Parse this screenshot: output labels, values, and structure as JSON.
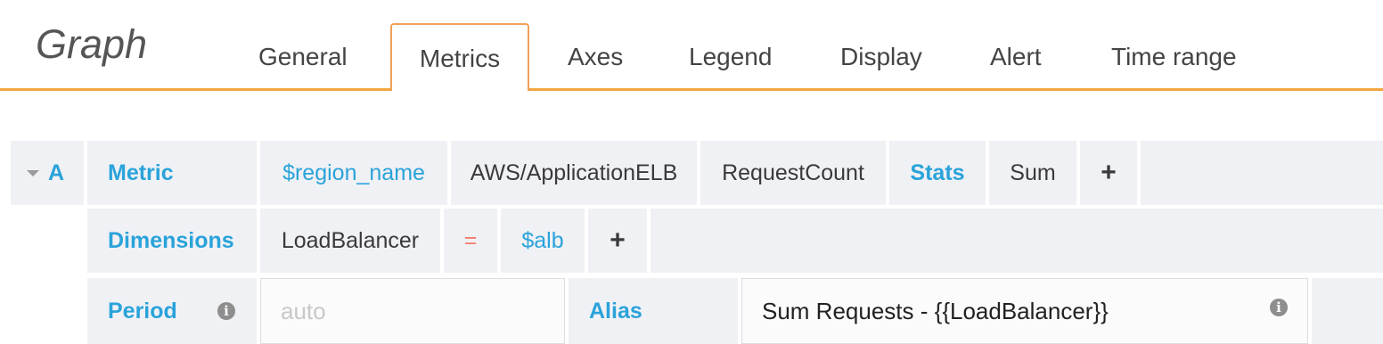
{
  "header": {
    "title": "Graph",
    "tabs": [
      "General",
      "Metrics",
      "Axes",
      "Legend",
      "Display",
      "Alert",
      "Time range"
    ],
    "active_tab": "Metrics",
    "accent_color": "#f2a63d"
  },
  "query": {
    "ref_id": "A",
    "metric_label": "Metric",
    "region": "$region_name",
    "namespace": "AWS/ApplicationELB",
    "metric_name": "RequestCount",
    "stats_label": "Stats",
    "stat": "Sum",
    "add_stat": "+",
    "dimensions_label": "Dimensions",
    "dimension_key": "LoadBalancer",
    "dimension_operator": "=",
    "dimension_value": "$alb",
    "add_dimension": "+",
    "period_label": "Period",
    "period_placeholder": "auto",
    "alias_label": "Alias",
    "alias_value": "Sum Requests - {{LoadBalancer}}",
    "info_icon": "i"
  }
}
